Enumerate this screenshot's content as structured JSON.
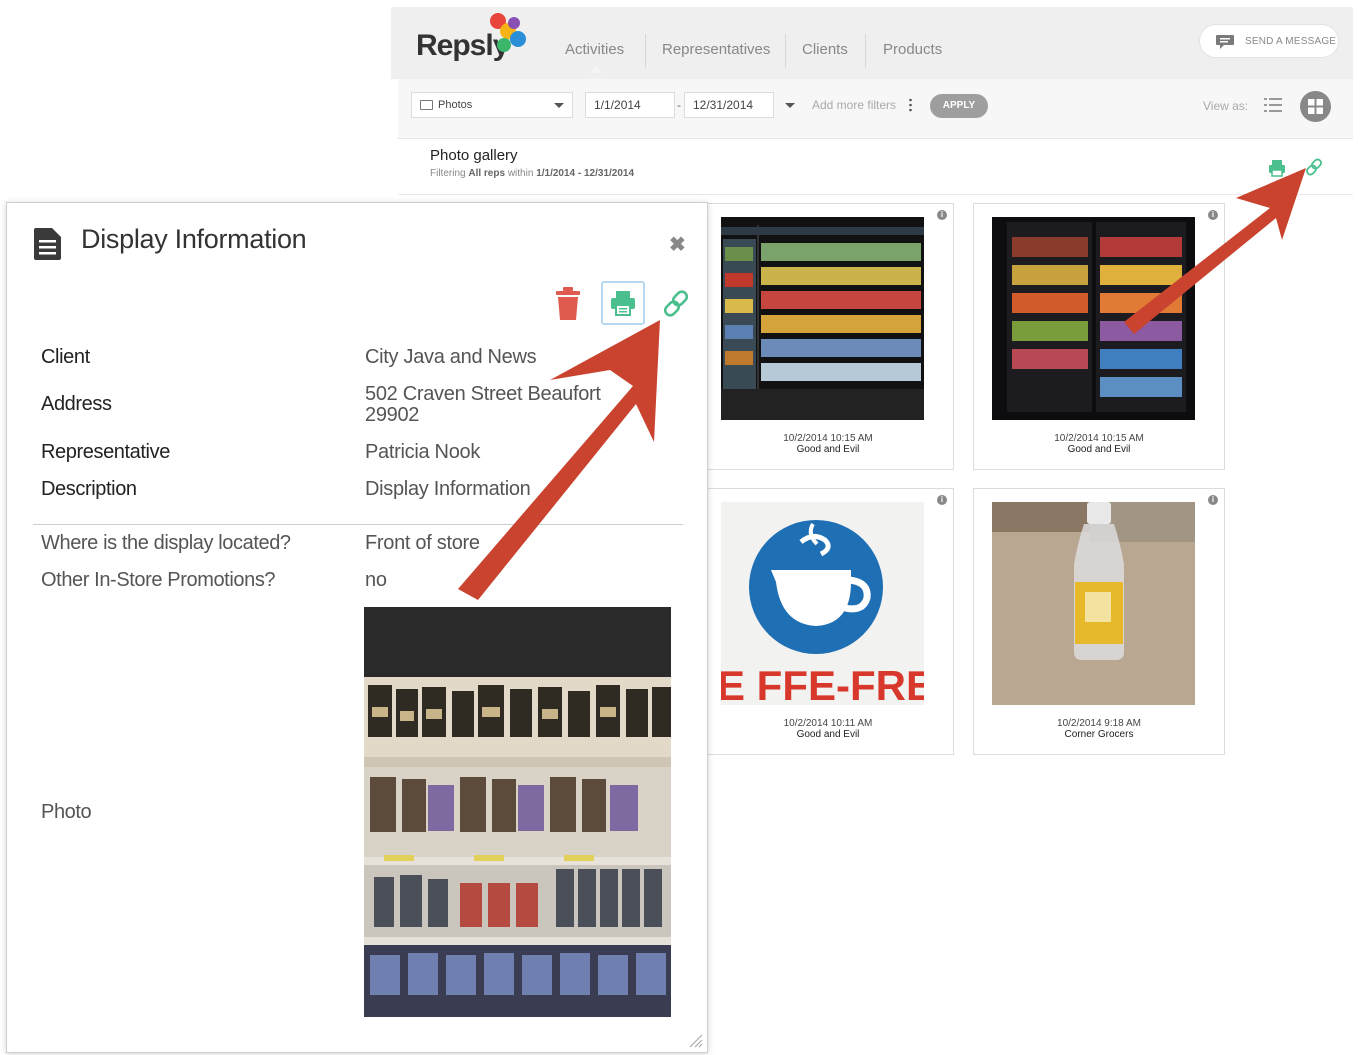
{
  "app": {
    "logo": "Repsly",
    "nav": [
      "Activities",
      "Representatives",
      "Clients",
      "Products"
    ],
    "send_message": "SEND A MESSAGE"
  },
  "filters": {
    "type": "Photos",
    "date_from": "1/1/2014",
    "date_to": "12/31/2014",
    "date_separator": "-",
    "more_filters": "Add more filters",
    "apply": "APPLY",
    "view_as": "View as:"
  },
  "gallery": {
    "title": "Photo gallery",
    "sub_prefix": "Filtering",
    "sub_reps": "All reps",
    "sub_mid": "within",
    "sub_range": "1/1/2014 - 12/31/2014",
    "cards": [
      {
        "time": "10/2/2014 10:15 AM",
        "client": "Good and Evil"
      },
      {
        "time": "10/2/2014 10:15 AM",
        "client": "Good and Evil"
      },
      {
        "time": "10/2/2014 10:11 AM",
        "client": "Good and Evil"
      },
      {
        "time": "10/2/2014 9:18 AM",
        "client": "Corner Grocers"
      }
    ],
    "sign_text": "E FFE-FRE"
  },
  "modal": {
    "title": "Display Information",
    "close": "✖",
    "fields": {
      "client_label": "Client",
      "client_value": "City Java and News",
      "address_label": "Address",
      "address_line1": "502 Craven Street Beaufort",
      "address_line2": "29902",
      "rep_label": "Representative",
      "rep_value": "Patricia Nook",
      "desc_label": "Description",
      "desc_value": "Display Information"
    },
    "questions": [
      {
        "q": "Where is the display located?",
        "a": "Front of store"
      },
      {
        "q": "Other In-Store Promotions?",
        "a": "no"
      }
    ],
    "photo_label": "Photo"
  },
  "colors": {
    "accent_green": "#4bbf8e",
    "trash_red": "#e05a4e",
    "arrow_red": "#c9432f",
    "print_border": "#b6d8f0"
  }
}
